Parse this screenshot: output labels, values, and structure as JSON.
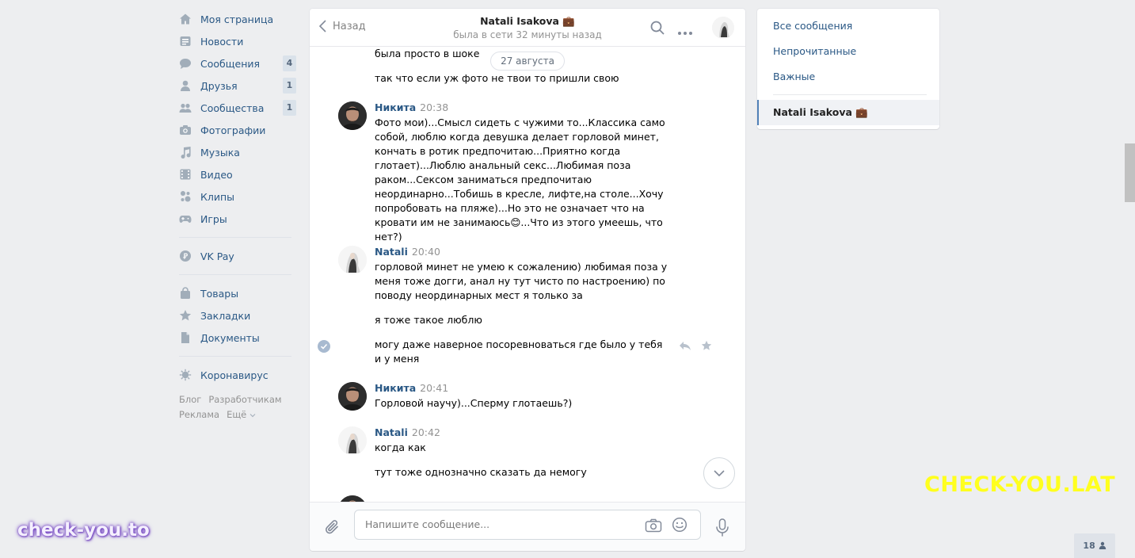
{
  "nav": {
    "items": [
      {
        "label": "Моя страница",
        "icon": "home-icon",
        "count": ""
      },
      {
        "label": "Новости",
        "icon": "news-icon",
        "count": ""
      },
      {
        "label": "Сообщения",
        "icon": "messages-icon",
        "count": "4"
      },
      {
        "label": "Друзья",
        "icon": "friends-icon",
        "count": "1"
      },
      {
        "label": "Сообщества",
        "icon": "groups-icon",
        "count": "1"
      },
      {
        "label": "Фотографии",
        "icon": "camera-icon",
        "count": ""
      },
      {
        "label": "Музыка",
        "icon": "music-icon",
        "count": ""
      },
      {
        "label": "Видео",
        "icon": "video-icon",
        "count": ""
      },
      {
        "label": "Клипы",
        "icon": "clips-icon",
        "count": ""
      },
      {
        "label": "Игры",
        "icon": "gamepad-icon",
        "count": ""
      }
    ],
    "vkpay": "VK Pay",
    "items2": [
      {
        "label": "Товары",
        "icon": "bag-icon"
      },
      {
        "label": "Закладки",
        "icon": "star-icon"
      },
      {
        "label": "Документы",
        "icon": "document-icon"
      }
    ],
    "corona": "Коронавирус",
    "footer": {
      "blog": "Блог",
      "dev": "Разработчикам",
      "ads": "Реклама",
      "more": "Ещё"
    }
  },
  "chat": {
    "back": "Назад",
    "peer_name": "Natali Isakova 💼",
    "peer_status": "была в сети 32 минуты назад",
    "date_pill": "27 августа",
    "messages": {
      "m0": "была просто в шоке",
      "m1": "так что если уж фото не твои то пришли свою",
      "a1": "Никита",
      "t1": "20:38",
      "m2": "Фото мои)...Смысл сидеть с чужими то...Классика само собой, люблю когда девушка делает горловой минет, кончать в ротик предпочитаю...Приятно когда глотает)...Люблю анальный секс...Любимая поза раком...Сексом заниматься предпочитаю неординарно...Тобишь в кресле, лифте,на столе...Хочу попробовать на пляже)...Но это не означает что на кровати им не занимаюсь😊...Что из этого умеешь, что нет?)",
      "a2": "Natali",
      "t2": "20:40",
      "m3": "горловой минет не умею к сожалению) любимая поза у меня тоже догги, анал ну тут чисто по настроению) по поводу неординарных мест я только за",
      "m4": "я тоже такое люблю",
      "m5": "могу даже наверное посоревноваться где было у тебя и у меня",
      "a3": "Никита",
      "t3": "20:41",
      "m6": "Горловой научу)...Сперму глотаешь?)",
      "a4": "Natali",
      "t4": "20:42",
      "m7": "когда как",
      "m8": "тут тоже однозначно сказать да немогу"
    },
    "composer_placeholder": "Напишите сообщение..."
  },
  "folders": {
    "all": "Все сообщения",
    "unread": "Непрочитанные",
    "important": "Важные",
    "active": "Natali Isakova 💼"
  },
  "watermark_1": "CHECK-YOU.LAT",
  "watermark_2": "check-you.to",
  "online_count": "18",
  "colors": {
    "link": "#2a5885",
    "accent": "#5181b8",
    "background": "#edeef0"
  }
}
